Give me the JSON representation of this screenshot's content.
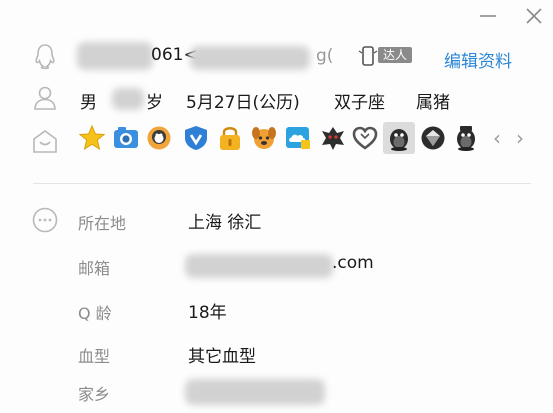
{
  "window": {
    "minimize_icon": "minimize-icon",
    "close_icon": "close-icon"
  },
  "profile": {
    "qq_fragment_1": "061<",
    "qq_fragment_2": "g(",
    "vip_badge_label": "达人",
    "edit_link": "编辑资料",
    "gender": "男",
    "age_suffix": "岁",
    "birthday": "5月27日(公历)",
    "zodiac": "双子座",
    "chinese_zodiac": "属猪"
  },
  "badges": [
    "star-icon",
    "camera-icon",
    "penguin-photo-icon",
    "shield-icon",
    "lock-icon",
    "puppy-icon",
    "cloud-icon",
    "dragon-icon",
    "heart-icon",
    "penguin-dark-icon",
    "diamond-icon",
    "penguin-dark-icon"
  ],
  "details": {
    "location_label": "所在地",
    "location_value": "上海 徐汇",
    "email_label": "邮箱",
    "email_suffix": ".com",
    "qage_label": "Q 龄",
    "qage_value": "18年",
    "blood_label": "血型",
    "blood_value": "其它血型",
    "hometown_label": "家乡"
  },
  "colors": {
    "link": "#2a86d6",
    "icon_gray": "#b8b8b8",
    "label_gray": "#8c8c8c"
  }
}
